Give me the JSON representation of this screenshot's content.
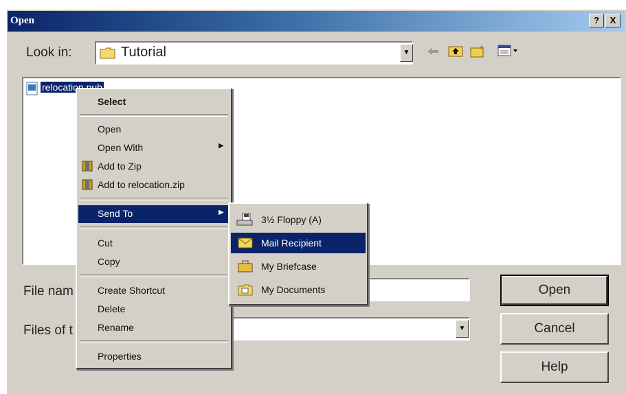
{
  "dialog": {
    "title": "Open",
    "help_btn": "?",
    "close_btn": "X"
  },
  "look_in": {
    "label": "Look in:",
    "value": "Tutorial"
  },
  "toolbar": {
    "icons": [
      "back-arrow-icon",
      "up-folder-icon",
      "new-folder-icon",
      "view-menu-icon"
    ]
  },
  "files": [
    {
      "name": "relocation.pub",
      "selected": true
    }
  ],
  "file_name": {
    "label": "File nam",
    "value": ""
  },
  "files_of_type": {
    "label": "Files of t",
    "value": ""
  },
  "buttons": {
    "open": "Open",
    "cancel": "Cancel",
    "help": "Help"
  },
  "context_menu": {
    "select": "Select",
    "open": "Open",
    "open_with": "Open With",
    "add_zip": "Add to Zip",
    "add_relocation_zip": "Add to relocation.zip",
    "send_to": "Send To",
    "cut": "Cut",
    "copy": "Copy",
    "create_shortcut": "Create Shortcut",
    "delete": "Delete",
    "rename": "Rename",
    "properties": "Properties"
  },
  "send_to_menu": {
    "floppy": "3½ Floppy (A)",
    "mail": "Mail Recipient",
    "briefcase": "My Briefcase",
    "documents": "My Documents"
  },
  "colors": {
    "face": "#d4d0c8",
    "highlight": "#0a246a",
    "title_gradient_end": "#a6caf0"
  }
}
